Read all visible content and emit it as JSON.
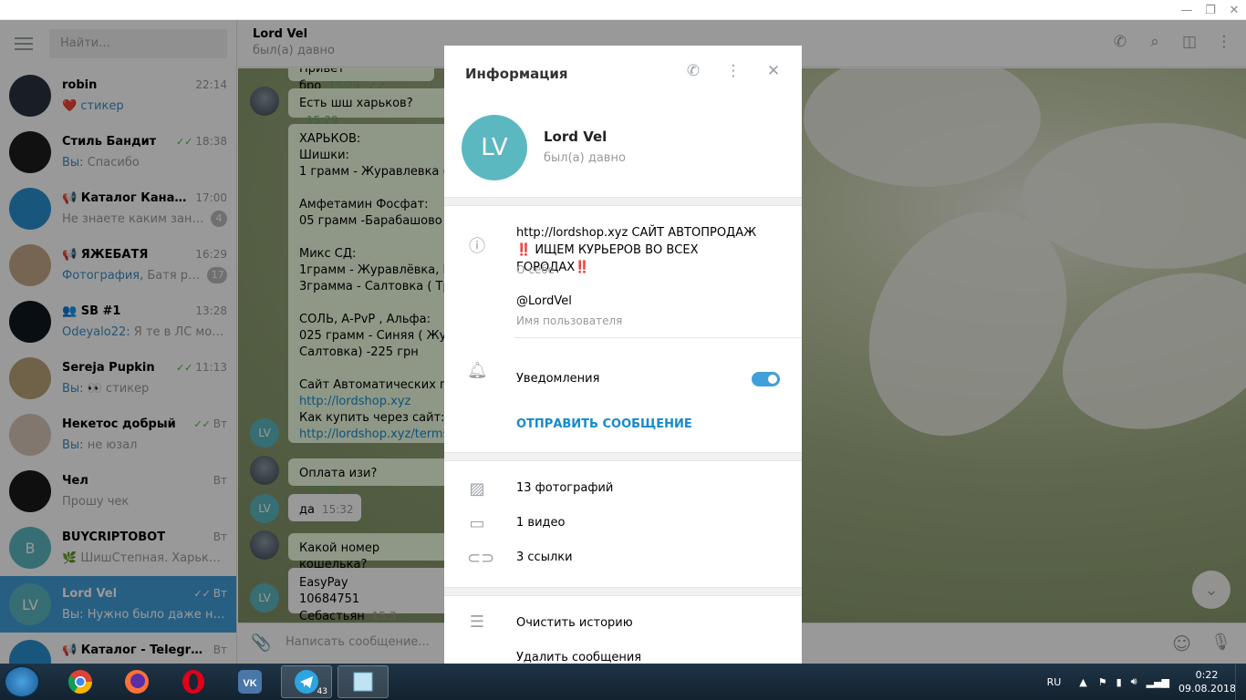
{
  "window": {
    "minimize": "—",
    "restore": "❐",
    "close": "✕"
  },
  "sidebar": {
    "search_placeholder": "Найти...",
    "chats": [
      {
        "name": "robin",
        "time": "22:14",
        "prefix": "❤️",
        "preview": "стикер",
        "highlight": true,
        "badge": "",
        "avatar_color": "#2a3340",
        "ticks": ""
      },
      {
        "name": "Стиль Бандит",
        "time": "18:38",
        "prefix": "Вы:",
        "preview": "Спасибо",
        "highlight": false,
        "badge": "",
        "avatar_color": "#1d1d1d",
        "ticks": "✓✓"
      },
      {
        "name": "📢 Каталог Каналов...",
        "time": "17:00",
        "prefix": "",
        "preview": "Не знаете каким занять...",
        "highlight": false,
        "badge": "4",
        "avatar_color": "#2a8fd3",
        "ticks": ""
      },
      {
        "name": "📢 ЯЖЕБАТЯ",
        "time": "16:29",
        "prefix": "Фотография,",
        "preview": "Батя реко...",
        "highlight": false,
        "badge": "17",
        "avatar_color": "#c7a98a",
        "ticks": ""
      },
      {
        "name": "👥 SB #1",
        "time": "13:28",
        "prefix": "Odeyalo22:",
        "preview": "Я те в ЛС могу с...",
        "highlight": false,
        "badge": "",
        "avatar_color": "#101820",
        "ticks": ""
      },
      {
        "name": "Sereja Pupkin",
        "time": "11:13",
        "prefix": "Вы:",
        "preview": "👀 стикер",
        "highlight": false,
        "badge": "",
        "avatar_color": "#b9a47a",
        "ticks": "✓✓"
      },
      {
        "name": "Некетос добрый",
        "time": "Вт",
        "prefix": "Вы:",
        "preview": "не юзал",
        "highlight": false,
        "badge": "",
        "avatar_color": "#d8c6b7",
        "ticks": "✓✓"
      },
      {
        "name": "Чел",
        "time": "Вт",
        "prefix": "",
        "preview": "Прошу чек",
        "highlight": false,
        "badge": "",
        "avatar_color": "#1a1a1a",
        "ticks": ""
      },
      {
        "name": "BUYCRIPTOBOT",
        "time": "Вт",
        "prefix": "🌿",
        "preview": "ШишСтепная. Харьков,...",
        "highlight": false,
        "badge": "",
        "avatar_color": "#5cb8c0",
        "initial": "B",
        "ticks": ""
      },
      {
        "name": "Lord Vel",
        "time": "Вт",
        "prefix": "Вы:",
        "preview": "Нужно было даже не п...",
        "highlight": false,
        "badge": "",
        "avatar_color": "#5cb8c0",
        "initial": "LV",
        "ticks": "✓✓",
        "active": true
      },
      {
        "name": "📢 Каталог - Telegram ...",
        "time": "Вт",
        "prefix": "",
        "preview": "",
        "highlight": false,
        "badge": "",
        "avatar_color": "#2a8fd3",
        "ticks": ""
      }
    ]
  },
  "chat": {
    "name": "Lord Vel",
    "status": "был(а) давно",
    "compose_placeholder": "Написать сообщение...",
    "messages": {
      "m0_text": "Привет бро",
      "m0_time": "15:29",
      "m1_text": "Есть шш харьков?",
      "m1_time": "15:29",
      "m2_lines": [
        "ХАРЬКОВ:",
        "Шишки:",
        "1 грамм - Журавлевка ( Дж",
        "",
        "Амфетамин Фосфат:",
        "05 грамм -Барабашово 18",
        "",
        "Микс СД:",
        "1грамм - Журавлёвка, Гер",
        "3грамма - Салтовка ( Трак",
        "",
        "СОЛЬ, А-PvP , Альфа:",
        "025 грамм - Синяя ( Журав",
        "Салтовка) -225 грн",
        "",
        "Сайт Автоматических про"
      ],
      "m2_link1": "http://lordshop.xyz",
      "m2_line_after": "Как купить через сайт:",
      "m2_link2": "http://lordshop.xyz/terms-",
      "m3_text": "Оплата изи?",
      "m3_time": "15:30",
      "m4_text": "да",
      "m4_time": "15:32",
      "m5_text": "Какой номер кошелька?",
      "m6_line1": "EasyPay",
      "m6_line2": "10684751 Себастьян",
      "m6_time": "15:3"
    },
    "avatar_initials": "LV"
  },
  "info": {
    "title": "Информация",
    "name": "Lord Vel",
    "status": "был(а) давно",
    "initials": "LV",
    "bio": "http://lordshop.xyz САЙТ АВТОПРОДАЖ ‼️ ИЩЕМ КУРЬЕРОВ ВО ВСЕХ ГОРОДАХ‼️",
    "bio_label": "О себе",
    "username": "@LordVel",
    "username_label": "Имя пользователя",
    "notifications": "Уведомления",
    "notifications_on": true,
    "send_message": "ОТПРАВИТЬ СООБЩЕНИЕ",
    "photos": "13 фотографий",
    "videos": "1 видео",
    "links": "3 ссылки",
    "clear_history": "Очистить историю",
    "delete_messages": "Удалить сообщения"
  },
  "taskbar": {
    "lang": "RU",
    "time": "0:22",
    "date": "09.08.2018",
    "telegram_badge": "43"
  },
  "colors": {
    "accent": "#419fd9",
    "link": "#168acd",
    "outgoing_bubble": "#eefee0",
    "avatar_teal": "#5cb8c0"
  }
}
